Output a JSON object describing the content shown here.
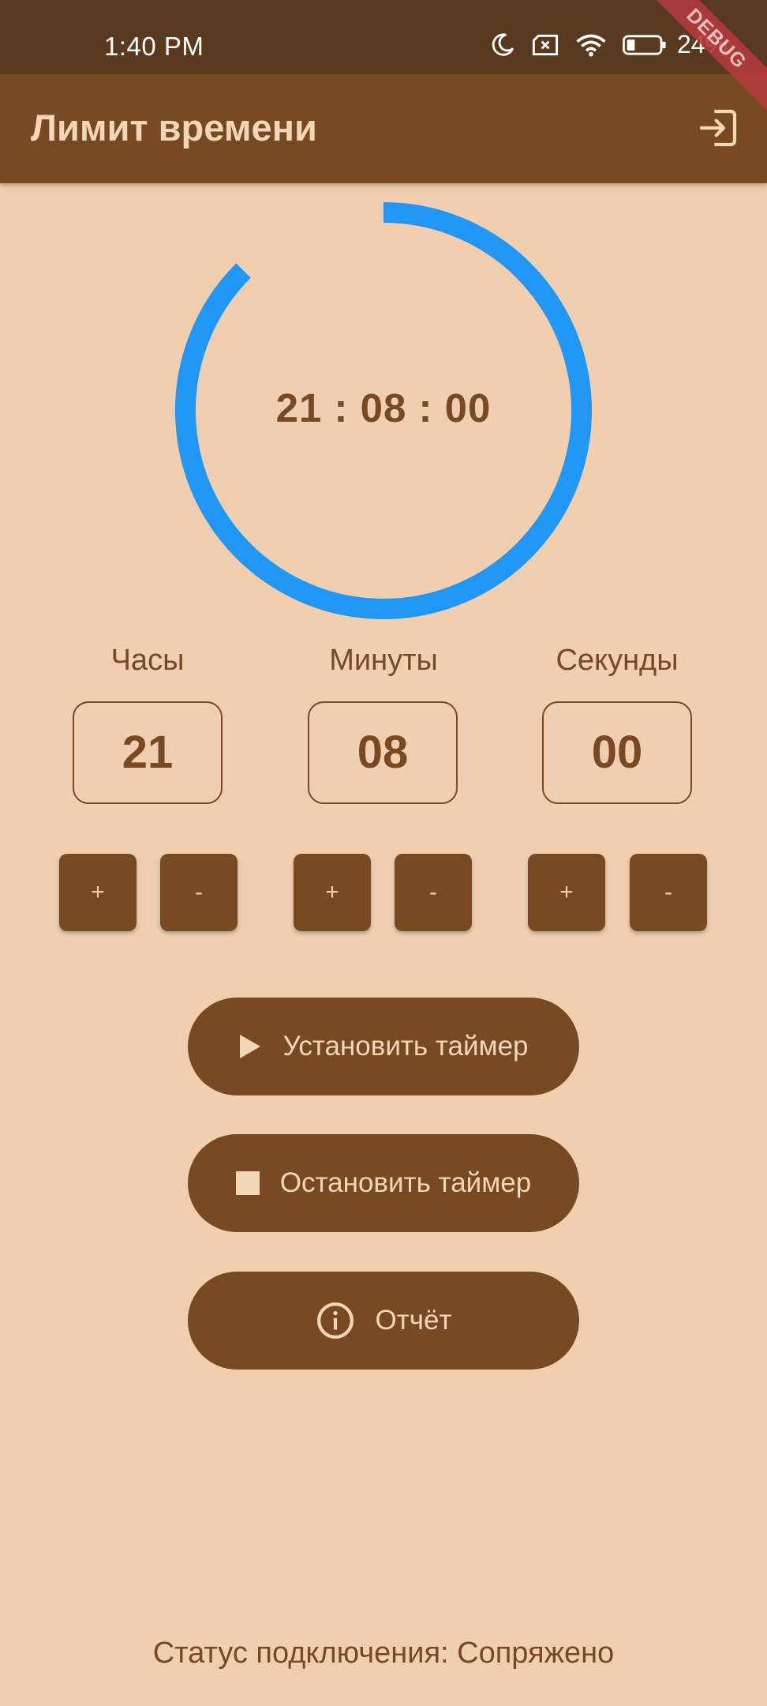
{
  "status_bar": {
    "time": "1:40 PM",
    "battery": "24%",
    "icons": [
      "moon-icon",
      "sim-off-icon",
      "wifi-icon",
      "battery-icon"
    ]
  },
  "debug_banner": "DEBUG",
  "app_bar": {
    "title": "Лимит времени",
    "action_icon": "exit-icon"
  },
  "timer": {
    "display": "21 : 08 : 00",
    "progress": 0.875,
    "ring_color": "#2196F3"
  },
  "units": [
    {
      "label": "Часы",
      "value": "21",
      "plus": "+",
      "minus": "-"
    },
    {
      "label": "Минуты",
      "value": "08",
      "plus": "+",
      "minus": "-"
    },
    {
      "label": "Секунды",
      "value": "00",
      "plus": "+",
      "minus": "-"
    }
  ],
  "buttons": {
    "set_timer": {
      "label": "Установить таймер",
      "icon": "play-icon"
    },
    "stop_timer": {
      "label": "Остановить таймер",
      "icon": "stop-icon"
    },
    "report": {
      "label": "Отчёт",
      "icon": "info-icon"
    }
  },
  "connection_status": "Статус подключения: Сопряжено",
  "colors": {
    "background": "#EFCFB0",
    "primary": "#774A24",
    "status_bar": "#5A3A1F",
    "accent": "#2196F3"
  }
}
